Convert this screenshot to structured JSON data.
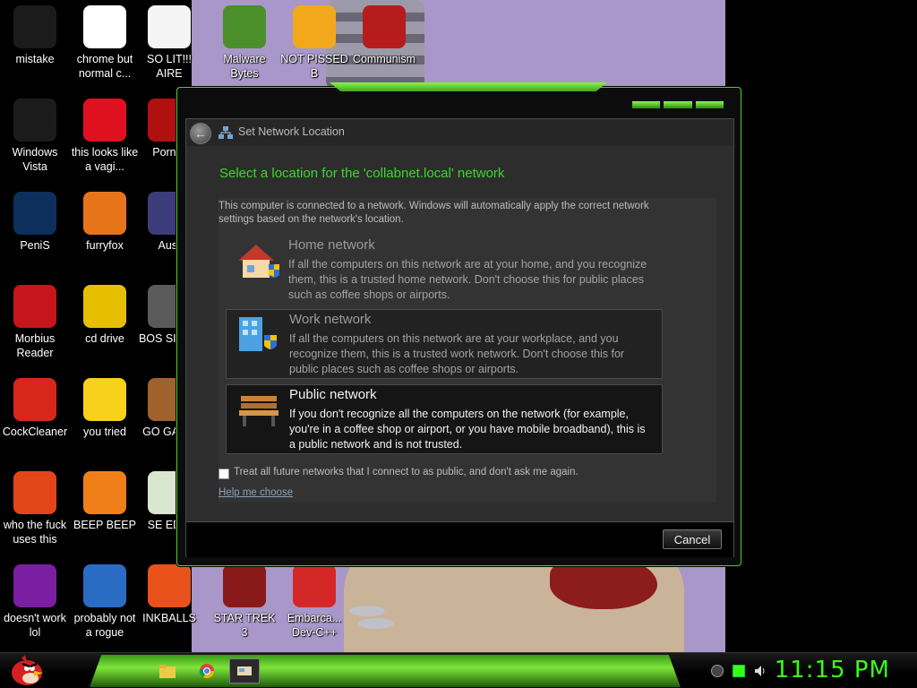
{
  "desktop_icons": [
    {
      "label": "mistake",
      "icon": "recycle-bin-icon",
      "color": "#1b1b1b"
    },
    {
      "label": "chrome but normal c...",
      "icon": "chrome-icon",
      "color": "#ffffff"
    },
    {
      "label": "SO LIT!!! AIRE",
      "icon": "playing-card-icon",
      "color": "#f4f4f4"
    },
    {
      "label": "Windows Vista",
      "icon": "recycle-bin-icon",
      "color": "#1b1b1b"
    },
    {
      "label": "this looks like a vagi...",
      "icon": "opera-icon",
      "color": "#e01020"
    },
    {
      "label": "Porn F",
      "icon": "adobe-flash-icon",
      "color": "#b01010"
    },
    {
      "label": "PeniS",
      "icon": "photoshop-icon",
      "color": "#0c2f5c"
    },
    {
      "label": "furryfox",
      "icon": "firefox-icon",
      "color": "#e8741a"
    },
    {
      "label": "Aust",
      "icon": "app-icon",
      "color": "#3c3c7a"
    },
    {
      "label": "Morbius Reader",
      "icon": "acrobat-reader-icon",
      "color": "#c4161c"
    },
    {
      "label": "cd drive",
      "icon": "cd-drive-icon",
      "color": "#e6c000"
    },
    {
      "label": "BOS SIMUL",
      "icon": "gear-ball-icon",
      "color": "#5a5a5a"
    },
    {
      "label": "CockCleaner",
      "icon": "ccleaner-icon",
      "color": "#d8261c"
    },
    {
      "label": "you tried",
      "icon": "star-icon",
      "color": "#f7d11a"
    },
    {
      "label": "GO GADG",
      "icon": "briefcase-icon",
      "color": "#a0622c"
    },
    {
      "label": "who the fuck uses this",
      "icon": "lightning-icon",
      "color": "#e3451b"
    },
    {
      "label": "BEEP BEEP",
      "icon": "vlc-cone-icon",
      "color": "#f07f1a"
    },
    {
      "label": "SE EDIT",
      "icon": "hex-editor-icon",
      "color": "#d9e7d0"
    },
    {
      "label": "doesn't work lol",
      "icon": "yahoo-messenger-icon",
      "color": "#7b1fa2"
    },
    {
      "label": "probably not a rogue",
      "icon": "system-tools-icon",
      "color": "#2a6cc4"
    },
    {
      "label": "INKBALLS",
      "icon": "ink-ball-icon",
      "color": "#e8521a"
    },
    {
      "label": "STAR TREK 3",
      "icon": "star-wars-icon",
      "color": "#8a1a1a"
    },
    {
      "label": "Embarca... Dev-C++",
      "icon": "devcpp-icon",
      "color": "#d42828"
    },
    {
      "label": "Malware Bytes",
      "icon": "shield-check-icon",
      "color": "#4a8f2a"
    },
    {
      "label": "NOT PISSED B",
      "icon": "angry-pig-icon",
      "color": "#f2a81c"
    },
    {
      "label": "Communism",
      "icon": "logo-icon",
      "color": "#b71c1c"
    }
  ],
  "dialog": {
    "title": "Set Network Location",
    "heading": "Select a location for the 'collabnet.local' network",
    "intro": "This computer is connected to a network. Windows will automatically apply the correct network settings based on the network's location.",
    "options": [
      {
        "title": "Home network",
        "description": "If all the computers on this network are at your home, and you recognize them, this is a trusted home network.  Don't choose this for public places such as coffee shops or airports."
      },
      {
        "title": "Work network",
        "description": "If all the computers on this network are at your workplace, and you recognize them, this is a trusted work network.  Don't choose this for public places such as coffee shops or airports."
      },
      {
        "title": "Public network",
        "description": "If you don't recognize all the computers on the network (for example, you're in a coffee shop or airport, or you have mobile broadband), this is a public network and is not trusted."
      }
    ],
    "checkbox_label": "Treat all future networks that I connect to as public, and don't ask me again.",
    "help_link": "Help me choose",
    "cancel_label": "Cancel"
  },
  "taskbar": {
    "clock": "11:15 PM",
    "accent": "#39ff14"
  }
}
